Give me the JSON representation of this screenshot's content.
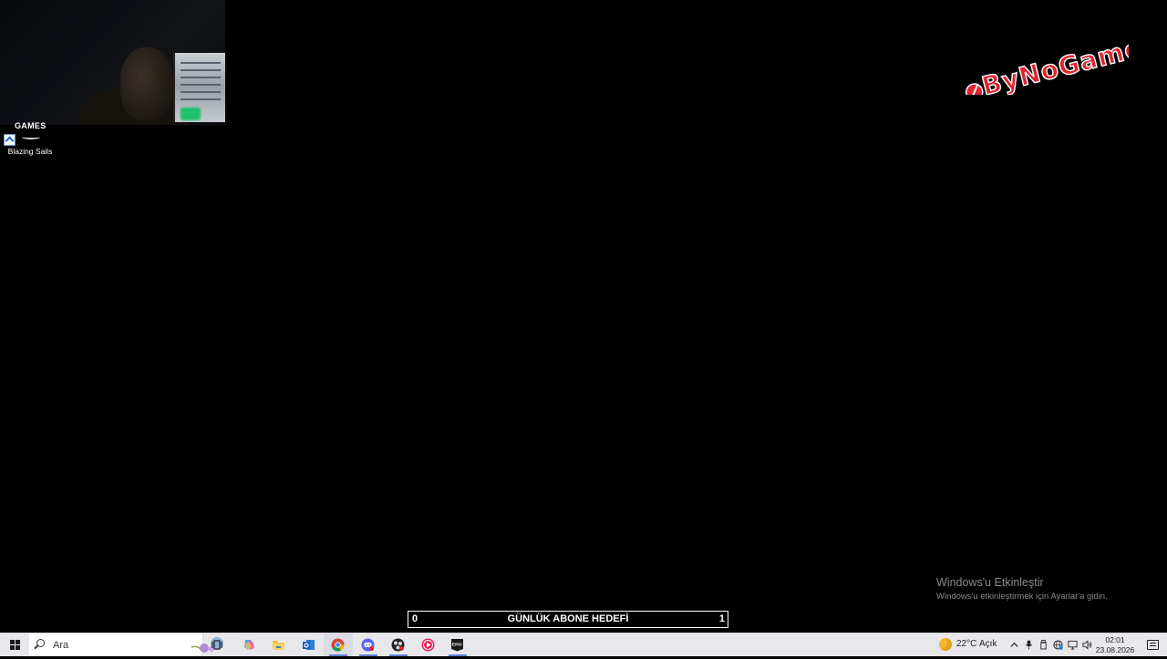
{
  "desktop": {
    "icons": [
      {
        "label": "Blazing Sails",
        "banner_text": "GAMES",
        "icon": "blazing-sails-game-icon"
      }
    ]
  },
  "logo": {
    "text": "ByNoGame",
    "colors": {
      "main": "#e0232e",
      "stroke": "#ffffff"
    }
  },
  "subscriber_goal": {
    "current": "0",
    "title": "GÜNLÜK ABONE HEDEFİ",
    "target": "1",
    "progress_fraction": 0.0
  },
  "activation_watermark": {
    "title": "Windows'u Etkinleştir",
    "subtitle": "Windows'u etkinleştirmek için Ayarlar'a gidin."
  },
  "taskbar": {
    "search": {
      "placeholder": "Ara",
      "value": ""
    },
    "pinned": [
      {
        "name": "task-view",
        "icon": "task-view-icon"
      },
      {
        "name": "copilot",
        "icon": "copilot-icon"
      },
      {
        "name": "file-explorer",
        "icon": "folder-icon"
      },
      {
        "name": "outlook",
        "icon": "outlook-icon"
      },
      {
        "name": "chrome",
        "icon": "chrome-icon"
      },
      {
        "name": "discord-app",
        "icon": "discord-icon"
      },
      {
        "name": "obs",
        "icon": "obs-icon"
      },
      {
        "name": "media-player",
        "icon": "play-icon"
      },
      {
        "name": "epic-games",
        "icon": "epic-games-icon",
        "text": "EPIC"
      }
    ],
    "weather": {
      "temperature": "22°C",
      "condition": "Açık",
      "icon": "moon-icon"
    },
    "clock": {
      "time": "02:01",
      "date": "23.08.2026"
    }
  },
  "colors": {
    "desktop_bg": "#000000",
    "taskbar_bg": "#e8e8ec",
    "accent": "#5a7fd6"
  }
}
